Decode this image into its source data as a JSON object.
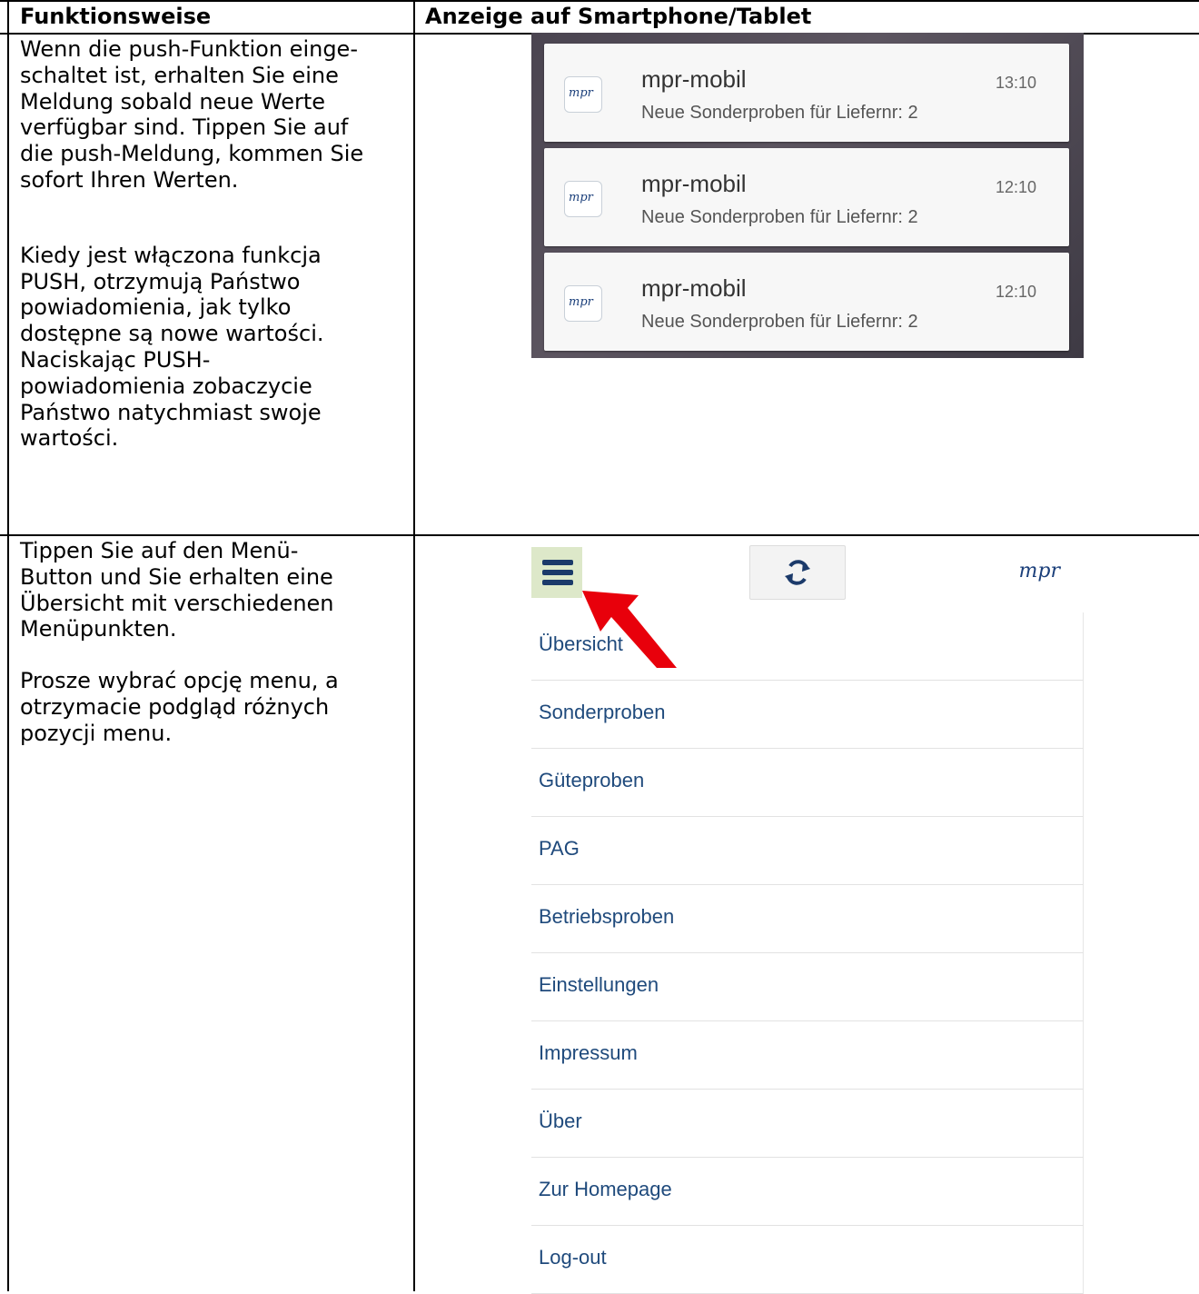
{
  "table": {
    "header_left": "Funktionsweise",
    "header_right": "Anzeige auf Smartphone/Tablet",
    "row1_de_lines": [
      "Wenn die push-Funktion einge-",
      "schaltet ist, erhalten Sie eine",
      "Meldung sobald neue Werte",
      "verfügbar sind. Tippen Sie auf",
      "die push-Meldung, kommen Sie",
      "sofort Ihren Werten."
    ],
    "row1_pl_lines": [
      "Kiedy jest włączona funkcja",
      "PUSH, otrzymują Państwo",
      "powiadomienia, jak tylko",
      "dostępne są nowe wartości.",
      "Naciskając PUSH-",
      "powiadomienia zobaczycie",
      "Państwo natychmiast swoje",
      "wartości."
    ],
    "row2_de_lines": [
      "Tippen Sie auf den Menü-",
      "Button und Sie erhalten eine",
      "Übersicht mit verschiedenen",
      "Menüpunkten."
    ],
    "row2_pl_lines": [
      "Prosze wybrać opcję menu, a",
      "otrzymacie podgląd różnych",
      "pozycji menu."
    ]
  },
  "notifications": [
    {
      "app": "mpr-mobil",
      "time": "13:10",
      "message": "Neue Sonderproben für Liefernr: 2",
      "logo": "mpr"
    },
    {
      "app": "mpr-mobil",
      "time": "12:10",
      "message": "Neue Sonderproben für Liefernr: 2",
      "logo": "mpr"
    },
    {
      "app": "mpr-mobil",
      "time": "12:10",
      "message": "Neue Sonderproben für Liefernr: 2",
      "logo": "mpr"
    }
  ],
  "app_bar": {
    "logo": "mpr",
    "menu_icon": "hamburger-icon",
    "refresh_icon": "refresh-icon"
  },
  "menu_items": [
    "Übersicht",
    "Sonderproben",
    "Güteproben",
    "PAG",
    "Betriebsproben",
    "Einstellungen",
    "Impressum",
    "Über",
    "Zur Homepage",
    "Log-out"
  ],
  "colors": {
    "menu_text": "#1f4a7c",
    "arrow": "#e8000b",
    "hamburger_bg": "#dde8c9"
  }
}
